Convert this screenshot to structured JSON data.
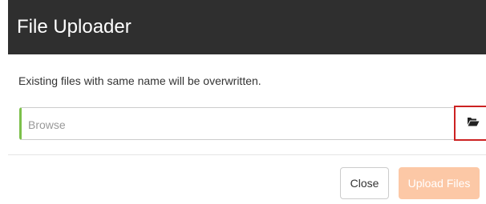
{
  "dialog": {
    "title": "File Uploader",
    "message": "Existing files with same name will be overwritten.",
    "file_input": {
      "placeholder": "Browse",
      "value": ""
    },
    "browse_icon": "folder-open-icon",
    "buttons": {
      "close_label": "Close",
      "upload_label": "Upload Files"
    }
  },
  "colors": {
    "header_bg": "#2f2f2f",
    "accent_green": "#7cc04b",
    "highlight_red": "#cc2222",
    "upload_disabled": "#fcc8a6"
  }
}
